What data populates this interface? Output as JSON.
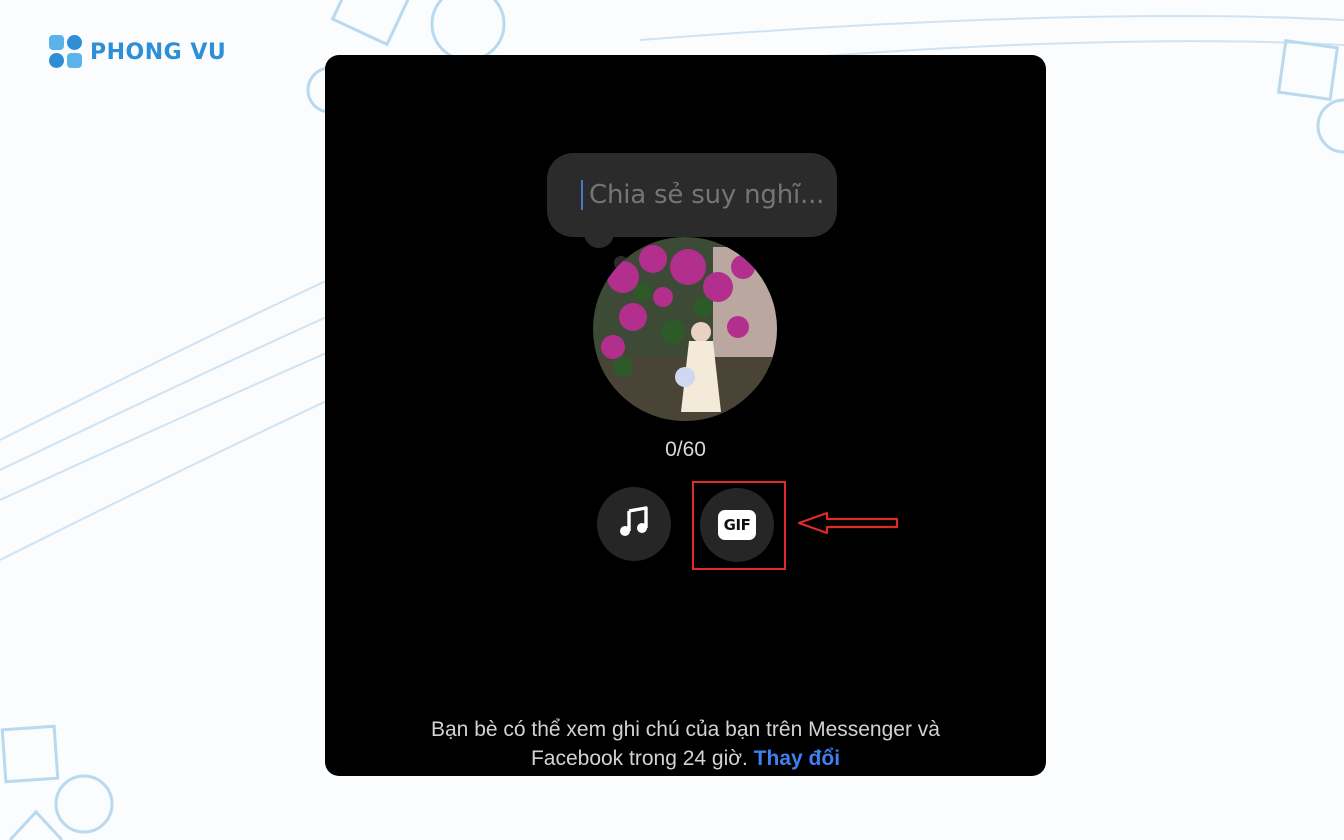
{
  "brand": {
    "name": "PHONG VU",
    "color": "#2f8fd6"
  },
  "note": {
    "placeholder": "Chia sẻ suy nghĩ...",
    "counter": "0/60"
  },
  "actions": {
    "music_icon": "music-note-icon",
    "gif_label": "GIF"
  },
  "footer": {
    "line1": "Bạn bè có thể xem ghi chú của bạn trên Messenger và",
    "line2": "Facebook trong 24 giờ.",
    "link": "Thay đổi"
  },
  "colors": {
    "panel": "#000000",
    "accent_link": "#3f7ff0",
    "annotation": "#e02a2a"
  }
}
